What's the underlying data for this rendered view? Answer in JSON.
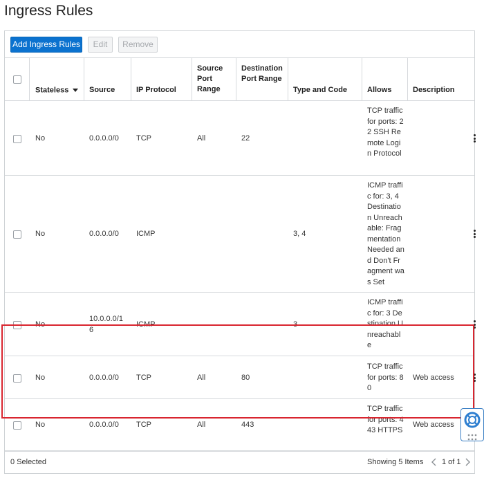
{
  "page": {
    "title": "Ingress Rules"
  },
  "toolbar": {
    "add_label": "Add Ingress Rules",
    "edit_label": "Edit",
    "remove_label": "Remove"
  },
  "table": {
    "headers": {
      "stateless": "Stateless",
      "source": "Source",
      "ip_protocol": "IP Protocol",
      "source_port_range": "Source Port Range",
      "destination_port_range": "Destination Port Range",
      "type_and_code": "Type and Code",
      "allows": "Allows",
      "description": "Description"
    },
    "rows": [
      {
        "stateless": "No",
        "source": "0.0.0.0/0",
        "protocol": "TCP",
        "source_port": "All",
        "dest_port": "22",
        "type_code": "",
        "allows": "TCP traffic for ports: 22 SSH Remote Login Protocol",
        "description": ""
      },
      {
        "stateless": "No",
        "source": "0.0.0.0/0",
        "protocol": "ICMP",
        "source_port": "",
        "dest_port": "",
        "type_code": "3, 4",
        "allows": "ICMP traffic for: 3, 4 Destination Unreachable: Fragmentation Needed and Don't Fragment was Set",
        "description": ""
      },
      {
        "stateless": "No",
        "source": "10.0.0.0/16",
        "protocol": "ICMP",
        "source_port": "",
        "dest_port": "",
        "type_code": "3",
        "allows": "ICMP traffic for: 3 Destination Unreachable",
        "description": ""
      },
      {
        "stateless": "No",
        "source": "0.0.0.0/0",
        "protocol": "TCP",
        "source_port": "All",
        "dest_port": "80",
        "type_code": "",
        "allows": "TCP traffic for ports: 80",
        "description": "Web access"
      },
      {
        "stateless": "No",
        "source": "0.0.0.0/0",
        "protocol": "TCP",
        "source_port": "All",
        "dest_port": "443",
        "type_code": "",
        "allows": "TCP traffic for ports: 443 HTTPS",
        "description": "Web access"
      }
    ]
  },
  "footer": {
    "selected": "0 Selected",
    "showing": "Showing 5 Items",
    "pagination": "1 of 1"
  },
  "icons": {
    "sort": "caret-down-icon",
    "kebab": "more-actions-icon",
    "help": "help-lifebuoy-icon",
    "prev": "chevron-left-icon",
    "next": "chevron-right-icon"
  },
  "colors": {
    "primary": "#0b72cf",
    "highlight": "#d9252f"
  }
}
